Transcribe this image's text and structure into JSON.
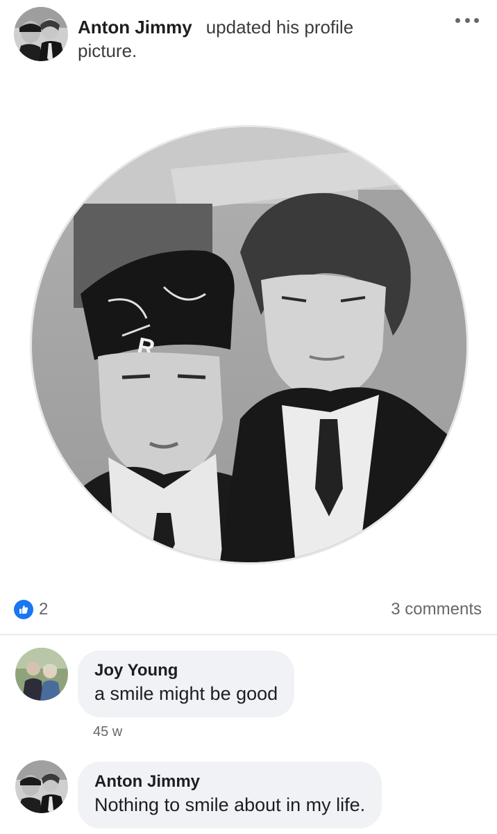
{
  "post": {
    "author": "Anton Jimmy",
    "action": "updated his profile picture.",
    "menu_icon": "more-horizontal-icon"
  },
  "reactions": {
    "icon": "like-thumb-icon",
    "like_color": "#1877f2",
    "count": "2",
    "comments_label": "3 comments"
  },
  "comments": [
    {
      "author": "Joy Young",
      "text": "a smile might be good",
      "time": "45 w"
    },
    {
      "author": "Anton Jimmy",
      "text": "Nothing to smile about in my life."
    }
  ],
  "colors": {
    "bubble": "#f0f2f5",
    "secondary_text": "#65676b"
  }
}
